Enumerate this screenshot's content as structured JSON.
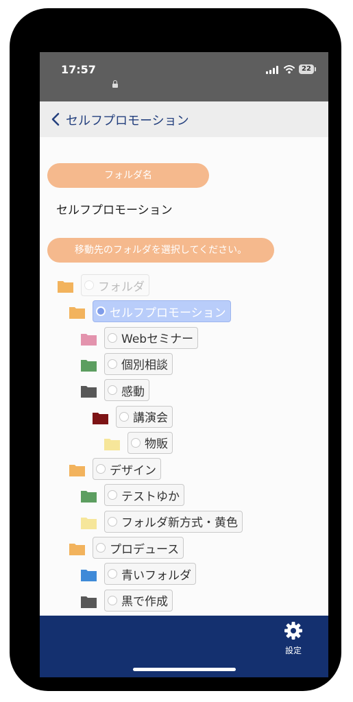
{
  "status": {
    "time": "17:57",
    "battery": "22"
  },
  "nav": {
    "back_icon": "chevron-left-icon",
    "title": "セルフプロモーション"
  },
  "form": {
    "name_label": "フォルダ名",
    "name_value": "セルフプロモーション",
    "move_label": "移動先のフォルダを選択してください。"
  },
  "tree": [
    {
      "label": "フォルダ",
      "color": "#f2b35d",
      "level": 0,
      "state": "disabled"
    },
    {
      "label": "セルフプロモーション",
      "color": "#f2b35d",
      "level": 1,
      "state": "selected"
    },
    {
      "label": "Webセミナー",
      "color": "#e393ad",
      "level": 2,
      "state": "normal"
    },
    {
      "label": "個別相談",
      "color": "#5c9e60",
      "level": 2,
      "state": "normal"
    },
    {
      "label": "感動",
      "color": "#585858",
      "level": 2,
      "state": "normal"
    },
    {
      "label": "講演会",
      "color": "#7d1315",
      "level": 3,
      "state": "normal"
    },
    {
      "label": "物販",
      "color": "#f6e69a",
      "level": 4,
      "state": "normal"
    },
    {
      "label": "デザイン",
      "color": "#f2b35d",
      "level": 1,
      "state": "normal"
    },
    {
      "label": "テストゆか",
      "color": "#5c9e60",
      "level": 2,
      "state": "normal"
    },
    {
      "label": "フォルダ新方式・黄色",
      "color": "#f6e69a",
      "level": 2,
      "state": "normal"
    },
    {
      "label": "プロデュース",
      "color": "#f2b35d",
      "level": 1,
      "state": "normal"
    },
    {
      "label": "青いフォルダ",
      "color": "#3f8ad8",
      "level": 2,
      "state": "normal"
    },
    {
      "label": "黒で作成",
      "color": "#585858",
      "level": 2,
      "state": "normal"
    }
  ],
  "tabbar": {
    "settings_label": "設定",
    "settings_icon": "gear-icon"
  },
  "colors": {
    "accent": "#f5b98d",
    "nav_text": "#24407e",
    "tabbar": "#14306f",
    "statusbar": "#5e5e5e",
    "selected": "#b9cdfa"
  }
}
